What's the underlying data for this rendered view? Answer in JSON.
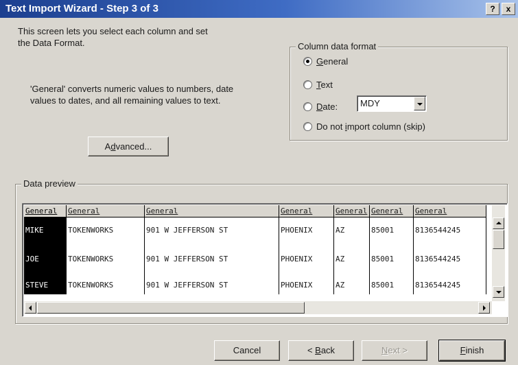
{
  "window": {
    "title": "Text Import Wizard - Step 3 of 3",
    "help_btn": "?",
    "close_btn": "x"
  },
  "description": {
    "line1": "This screen lets you select each column and set",
    "line2": "the Data Format.",
    "line3": "'General' converts numeric values to numbers, date",
    "line4": "values to dates, and all remaining values to text."
  },
  "advanced_button": {
    "label_first": "A",
    "label_u": "d",
    "label_rest": "vanced..."
  },
  "column_format": {
    "legend": "Column data format",
    "general": {
      "pre": "",
      "u": "G",
      "post": "eneral",
      "checked": true
    },
    "text": {
      "pre": "",
      "u": "T",
      "post": "ext",
      "checked": false
    },
    "date": {
      "pre": "",
      "u": "D",
      "post": "ate:",
      "checked": false
    },
    "date_value": "MDY",
    "skip": {
      "pre": "Do not ",
      "u": "i",
      "post": "mport column (skip)",
      "checked": false
    }
  },
  "preview": {
    "legend": "Data preview",
    "headers": [
      "General",
      "General",
      "General",
      "General",
      "General",
      "General",
      "General"
    ],
    "rows": [
      [
        "MIKE",
        "TOKENWORKS",
        "901 W JEFFERSON ST",
        "PHOENIX",
        "AZ",
        "85001",
        "8136544245"
      ],
      [
        "JOE",
        "TOKENWORKS",
        "901 W JEFFERSON ST",
        "PHOENIX",
        "AZ",
        "85001",
        "8136544245"
      ],
      [
        "STEVE",
        "TOKENWORKS",
        "901 W JEFFERSON ST",
        "PHOENIX",
        "AZ",
        "85001",
        "8136544245"
      ]
    ]
  },
  "buttons": {
    "cancel": "Cancel",
    "back": {
      "pre": "< ",
      "u": "B",
      "post": "ack"
    },
    "next": {
      "pre": "",
      "u": "N",
      "post": "ext >"
    },
    "finish": {
      "pre": "",
      "u": "F",
      "post": "inish"
    }
  }
}
